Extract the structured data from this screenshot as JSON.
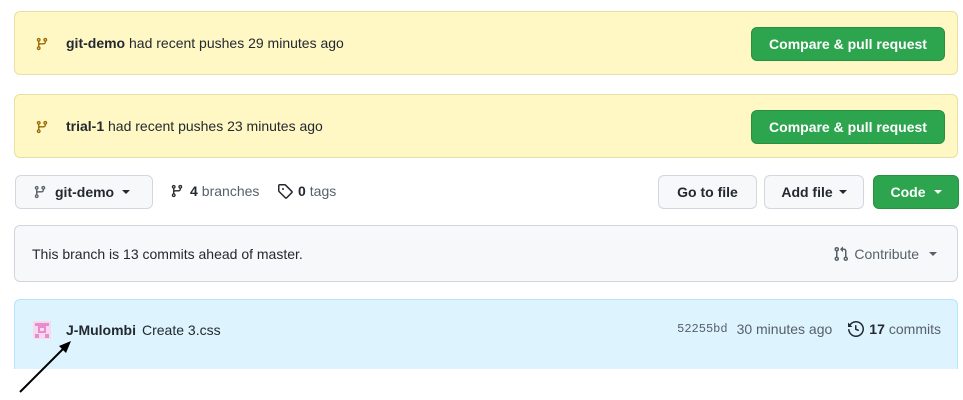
{
  "banners": [
    {
      "branch": "git-demo",
      "text": "had recent pushes 29 minutes ago",
      "button": "Compare & pull request"
    },
    {
      "branch": "trial-1",
      "text": "had recent pushes 23 minutes ago",
      "button": "Compare & pull request"
    }
  ],
  "toolbar": {
    "branch_select": "git-demo",
    "branches_count": "4",
    "branches_label": "branches",
    "tags_count": "0",
    "tags_label": "tags",
    "go_to_file": "Go to file",
    "add_file": "Add file",
    "code": "Code"
  },
  "ahead": {
    "text": "This branch is 13 commits ahead of master.",
    "contribute": "Contribute"
  },
  "commit": {
    "author": "J-Mulombi",
    "message": "Create 3.css",
    "sha": "52255bd",
    "time": "30 minutes ago",
    "count": "17",
    "count_label": "commits"
  },
  "colors": {
    "banner_bg": "#fff8c5",
    "primary_green": "#2da44e",
    "commit_bg": "#ddf4ff",
    "branch_icon": "#9a6700"
  }
}
